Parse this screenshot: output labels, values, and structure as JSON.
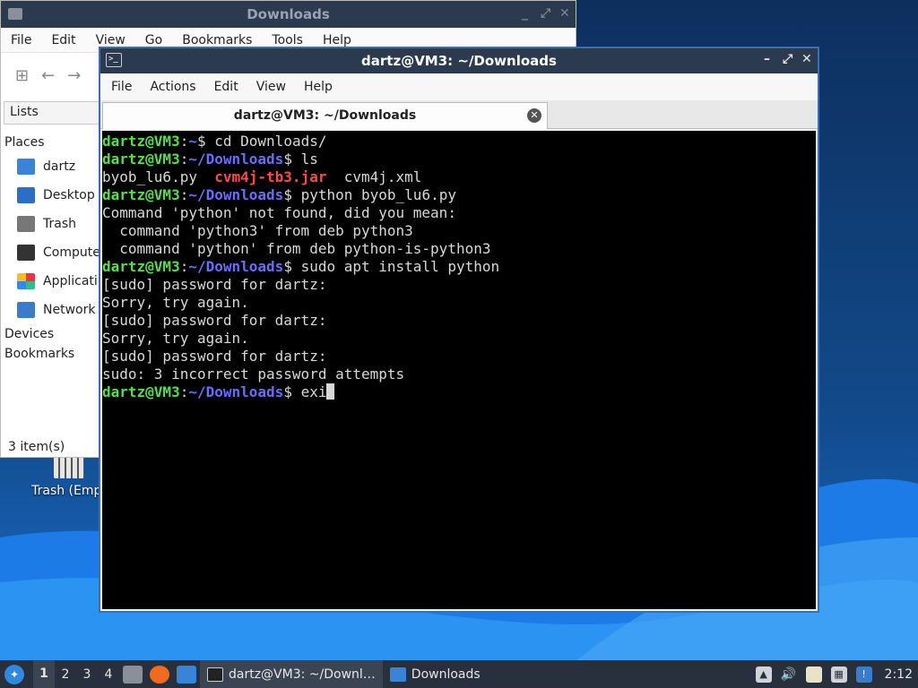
{
  "desktop": {
    "trash_label": "Trash (Empt"
  },
  "file_manager": {
    "title": "Downloads",
    "menu": [
      "File",
      "Edit",
      "View",
      "Go",
      "Bookmarks",
      "Tools",
      "Help"
    ],
    "lists_label": "Lists",
    "places_header": "Places",
    "places": [
      {
        "label": "dartz",
        "icon": "home-folder-icon"
      },
      {
        "label": "Desktop",
        "icon": "desktop-icon"
      },
      {
        "label": "Trash",
        "icon": "trash-icon"
      },
      {
        "label": "Compute",
        "icon": "computer-icon"
      },
      {
        "label": "Applicati",
        "icon": "applications-icon"
      },
      {
        "label": "Network",
        "icon": "network-icon"
      }
    ],
    "devices_header": "Devices",
    "bookmarks_header": "Bookmarks",
    "status": "3 item(s)"
  },
  "terminal": {
    "title": "dartz@VM3: ~/Downloads",
    "menu": [
      "File",
      "Actions",
      "Edit",
      "View",
      "Help"
    ],
    "tab_label": "dartz@VM3: ~/Downloads",
    "prompt_user": "dartz@VM3",
    "colors": {
      "user": "#54e04a",
      "path": "#6a6dff",
      "jar": "#ff4b4b",
      "text": "#d8d8d8"
    },
    "lines": [
      {
        "user": "dartz@VM3",
        "sep": ":",
        "path": "~",
        "sym": "$ ",
        "cmd": "cd Downloads/"
      },
      {
        "user": "dartz@VM3",
        "sep": ":",
        "path": "~/Downloads",
        "sym": "$ ",
        "cmd": "ls"
      },
      {
        "files": [
          "byob_lu6.py  ",
          "cvm4j-tb3.jar",
          "  cvm4j.xml"
        ]
      },
      {
        "user": "dartz@VM3",
        "sep": ":",
        "path": "~/Downloads",
        "sym": "$ ",
        "cmd": "python byob_lu6.py"
      },
      {
        "text": "Command 'python' not found, did you mean:"
      },
      {
        "text": "  command 'python3' from deb python3"
      },
      {
        "text": "  command 'python' from deb python-is-python3"
      },
      {
        "user": "dartz@VM3",
        "sep": ":",
        "path": "~/Downloads",
        "sym": "$ ",
        "cmd": "sudo apt install python"
      },
      {
        "text": "[sudo] password for dartz:"
      },
      {
        "text": "Sorry, try again."
      },
      {
        "text": "[sudo] password for dartz:"
      },
      {
        "text": "Sorry, try again."
      },
      {
        "text": "[sudo] password for dartz:"
      },
      {
        "text": "sudo: 3 incorrect password attempts"
      },
      {
        "user": "dartz@VM3",
        "sep": ":",
        "path": "~/Downloads",
        "sym": "$ ",
        "cmd": "exi",
        "cursor": true
      }
    ]
  },
  "taskbar": {
    "workspaces": [
      "1",
      "2",
      "3",
      "4"
    ],
    "active_workspace": "1",
    "tasks": [
      {
        "label": "dartz@VM3: ~/Downl…",
        "icon": "terminal-icon"
      },
      {
        "label": "Downloads",
        "icon": "folder-icon"
      }
    ],
    "clock": "2:12"
  }
}
